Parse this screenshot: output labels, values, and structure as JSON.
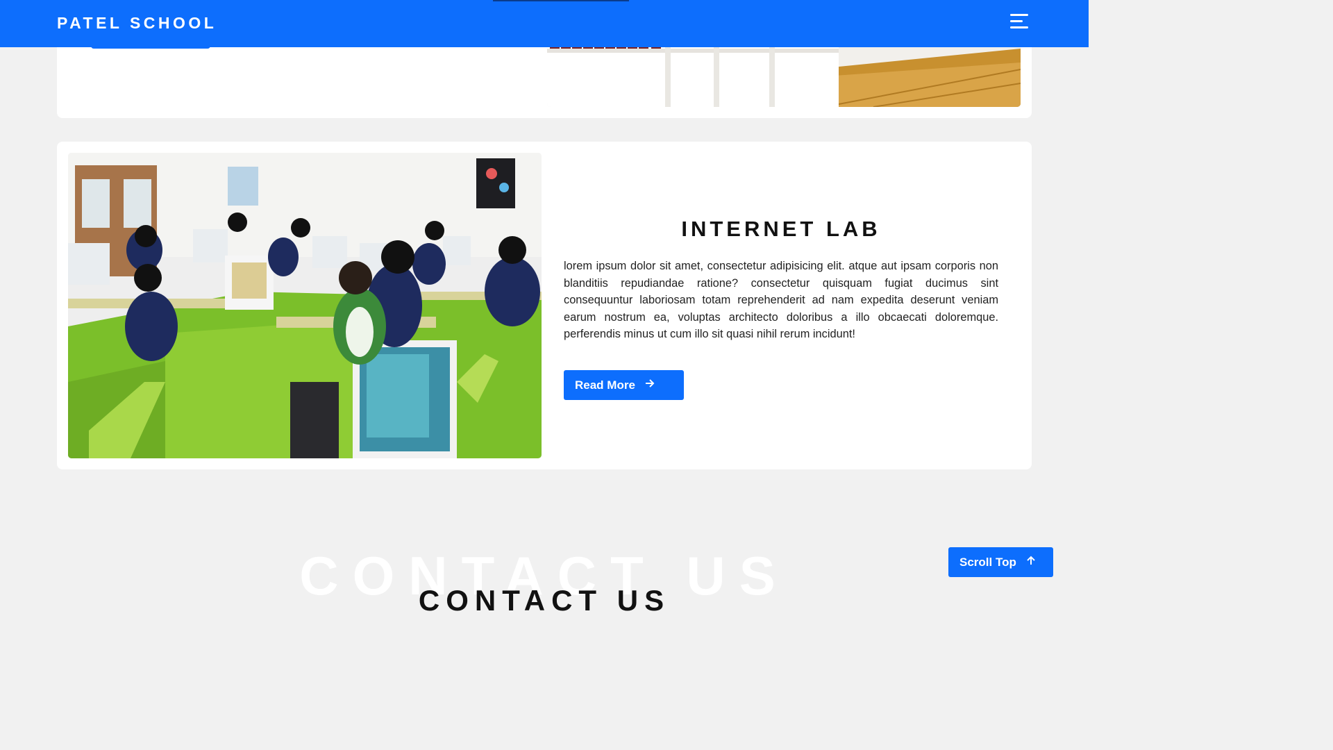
{
  "header": {
    "logo": "PATEL SCHOOL",
    "menu_icon": "hamburger-menu-icon"
  },
  "features": [
    {
      "title": "",
      "image": "library-bookshelf-photo"
    },
    {
      "title": "INTERNET LAB",
      "description": "lorem ipsum dolor sit amet, consectetur adipisicing elit. atque aut ipsam corporis non blanditiis repudiandae ratione? consectetur quisquam fugiat ducimus sint consequuntur laboriosam totam reprehenderit ad nam expedita deserunt veniam earum nostrum ea, voluptas architecto doloribus a illo obcaecati doloremque. perferendis minus ut cum illo sit quasi nihil rerum incidunt!",
      "button_label": "Read More",
      "button_icon": "arrow-right-icon",
      "image": "computer-lab-photo"
    }
  ],
  "contact": {
    "background_title": "CONTACT US",
    "title": "CONTACT US"
  },
  "scroll_top": {
    "label": "Scroll Top",
    "icon": "arrow-up-icon"
  },
  "colors": {
    "primary": "#0d6efd",
    "page_bg": "#f1f1f1",
    "card_bg": "#ffffff"
  }
}
